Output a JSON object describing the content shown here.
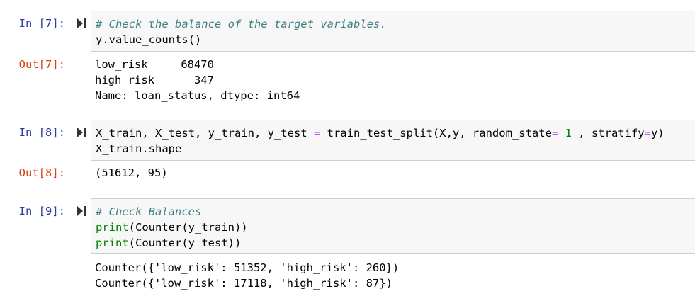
{
  "cells": [
    {
      "in_prompt": "In [7]:",
      "code": {
        "comment": "# Check the balance of the target variables.",
        "line2": "y.value_counts()"
      },
      "out_prompt": "Out[7]:",
      "output": [
        "low_risk     68470",
        "high_risk      347",
        "Name: loan_status, dtype: int64"
      ]
    },
    {
      "in_prompt": "In [8]:",
      "code": {
        "l1_a": "X_train, X_test, y_train, y_test ",
        "l1_eq": "=",
        "l1_b": " train_test_split(X,y, random_state",
        "l1_eq2": "=",
        "l1_sp": " ",
        "l1_num": "1",
        "l1_c": " , stratify",
        "l1_eq3": "=",
        "l1_d": "y)",
        "line2": "X_train.shape"
      },
      "out_prompt": "Out[8]:",
      "output": [
        "(51612, 95)"
      ]
    },
    {
      "in_prompt": "In [9]:",
      "code": {
        "comment": "# Check Balances",
        "print_kw": "print",
        "line2_rest": "(Counter(y_train))",
        "line3_rest": "(Counter(y_test))"
      },
      "output": [
        "Counter({'low_risk': 51352, 'high_risk': 260})",
        "Counter({'low_risk': 17118, 'high_risk': 87})"
      ]
    }
  ],
  "colors": {
    "in_prompt": "#303f9f",
    "out_prompt": "#d84315",
    "comment": "#408080",
    "builtin": "#008000",
    "operator": "#aa22ff",
    "input_bg": "#f7f7f7"
  },
  "icons": {
    "run": "run-cell-icon"
  }
}
